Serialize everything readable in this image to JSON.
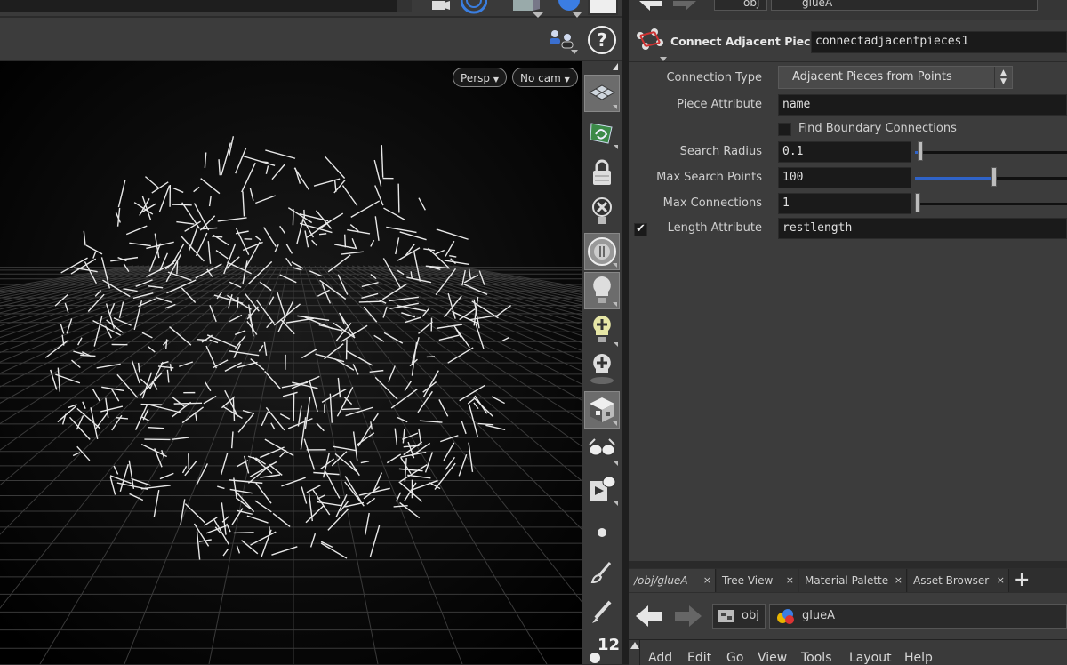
{
  "viewport": {
    "persp_label": "Persp",
    "camera_label": "No cam",
    "help_glyph": "?"
  },
  "toolbar": {
    "badge_number": "12"
  },
  "path_top": {
    "obj_label": "obj",
    "node_label": "glueA"
  },
  "node": {
    "type_label": "Connect Adjacent Pieces",
    "name_value": "connectadjacentpieces1"
  },
  "params": {
    "connection_type_label": "Connection Type",
    "connection_type_value": "Adjacent Pieces from Points",
    "piece_attribute_label": "Piece Attribute",
    "piece_attribute_value": "name",
    "find_boundary_label": "Find Boundary Connections",
    "find_boundary_checked": false,
    "search_radius_label": "Search Radius",
    "search_radius_value": "0.1",
    "search_radius_slider": 0.02,
    "max_search_points_label": "Max Search Points",
    "max_search_points_value": "100",
    "max_search_points_slider": 0.5,
    "max_connections_label": "Max Connections",
    "max_connections_value": "1",
    "max_connections_slider": 0.0,
    "length_attribute_label": "Length Attribute",
    "length_attribute_checked": true,
    "length_attribute_value": "restlength"
  },
  "tabs": [
    {
      "label": "/obj/glueA",
      "close": "×"
    },
    {
      "label": "Tree View",
      "close": "×"
    },
    {
      "label": "Material Palette",
      "close": "×"
    },
    {
      "label": "Asset Browser",
      "close": "×"
    }
  ],
  "tab_add": "+",
  "path_bottom": {
    "obj_label": "obj",
    "node_label": "glueA"
  },
  "menu": [
    "Add",
    "Edit",
    "Go",
    "View",
    "Tools",
    "Layout",
    "Help"
  ],
  "colors": {
    "panel_bg": "#3c3c3c",
    "field_bg": "#1a1a1a",
    "viewport_bg": "#000000",
    "grid": "#3a3a3a",
    "lines": "#e8e8e8",
    "accent_blue": "#2f63c8"
  }
}
